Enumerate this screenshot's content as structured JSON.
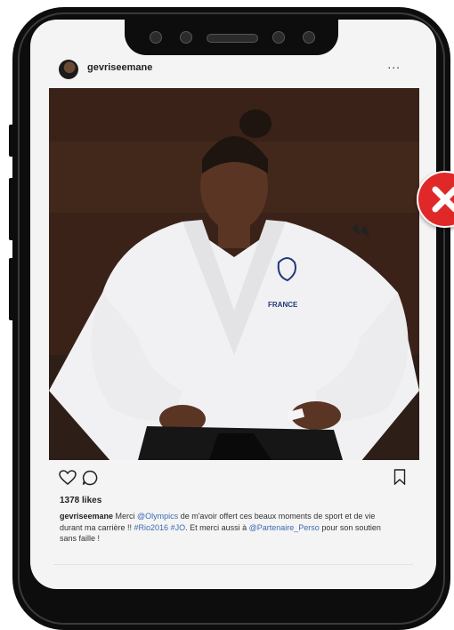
{
  "post": {
    "username": "gevriseemane",
    "more_label": "...",
    "likes": "1378 likes",
    "caption": {
      "author": "gevriseemane",
      "text_1": " Merci ",
      "mention_1": "@Olympics",
      "text_2": " de m'avoir offert ces beaux moments de sport et de vie durant ma carrière !! ",
      "hashtag_1": "#Rio2016",
      "text_3": " ",
      "hashtag_2": "#JO",
      "text_4": ". Et merci aussi à ",
      "mention_2": "@Partenaire_Perso",
      "text_5": " pour son soutien sans faille !"
    },
    "photo": {
      "jacket_text": "FRANCE",
      "description_icon": "judoka-photo"
    }
  },
  "icons": {
    "heart": "heart-icon",
    "comment": "comment-icon",
    "bookmark": "bookmark-icon",
    "close": "close-icon"
  },
  "colors": {
    "link": "#3d6bb3",
    "close_badge": "#e02828",
    "phone": "#0d0d0d"
  }
}
